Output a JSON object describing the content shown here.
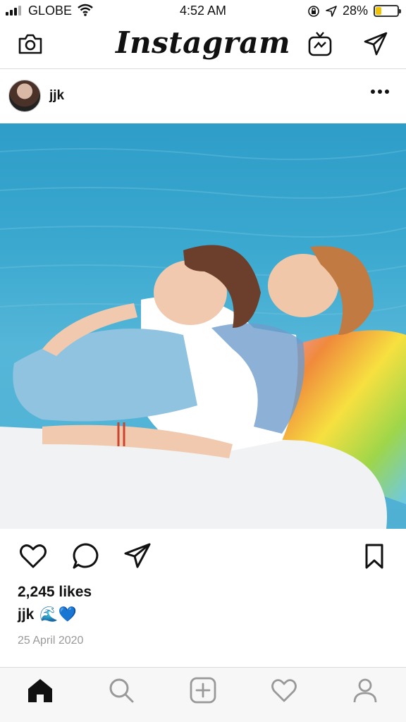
{
  "status_bar": {
    "carrier": "GLOBE",
    "time": "4:52 AM",
    "battery_percent": "28%",
    "battery_level": 0.28,
    "battery_color": "#f2c200"
  },
  "header": {
    "logo": "Instagram",
    "icons": [
      "camera-icon",
      "igtv-icon",
      "direct-message-icon"
    ]
  },
  "post": {
    "username": "jjk",
    "likes": "2,245 likes",
    "caption_user": "jjk",
    "caption_emoji": "🌊💙",
    "date": "25 April 2020"
  },
  "actions": {
    "icons": [
      "heart-icon",
      "comment-icon",
      "share-icon",
      "bookmark-icon"
    ]
  },
  "tab_bar": {
    "items": [
      "home-icon",
      "search-icon",
      "add-post-icon",
      "activity-heart-icon",
      "profile-icon"
    ],
    "active": "home-icon"
  },
  "colors": {
    "text": "#111111",
    "muted": "#999999",
    "border": "#dbdbdb",
    "water": "#3aa8cf"
  }
}
